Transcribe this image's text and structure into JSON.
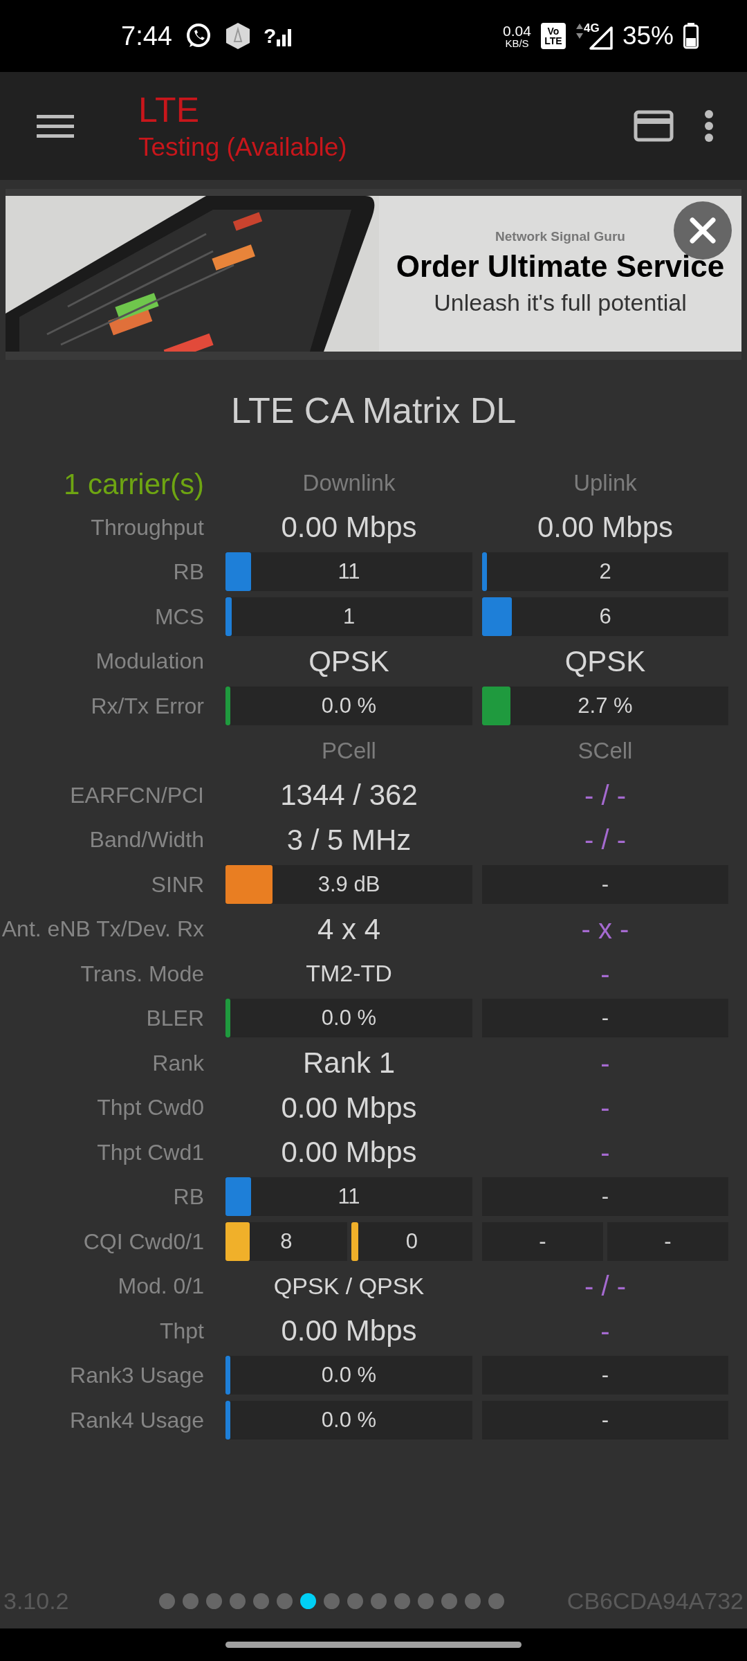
{
  "status_bar": {
    "time": "7:44",
    "signal_mark": "?",
    "speed": "0.04",
    "speed_unit": "KB/S",
    "volte_top": "Vo",
    "volte_bottom": "LTE",
    "network": "4G",
    "battery": "35%"
  },
  "app_bar": {
    "title": "LTE",
    "subtitle": "Testing (Available)"
  },
  "ad": {
    "brand": "Network Signal Guru",
    "headline": "Order Ultimate Service",
    "tagline": "Unleash it's full potential"
  },
  "matrix": {
    "title": "LTE CA Matrix DL",
    "rows": [
      {
        "kind": "header",
        "label": "1 carrier(s)",
        "cells": [
          {
            "kind": "heading",
            "text": "Downlink"
          },
          {
            "kind": "heading",
            "text": "Uplink"
          }
        ]
      },
      {
        "kind": "data",
        "label": "Throughput",
        "cells": [
          {
            "kind": "big",
            "text": "0.00 Mbps"
          },
          {
            "kind": "big",
            "text": "0.00 Mbps"
          }
        ]
      },
      {
        "kind": "data",
        "label": "RB",
        "cells": [
          {
            "kind": "bar",
            "text": "11",
            "level": 0.105,
            "color": "#1e7fd8"
          },
          {
            "kind": "bar",
            "text": "2",
            "level": 0.02,
            "color": "#1e7fd8"
          }
        ]
      },
      {
        "kind": "data",
        "label": "MCS",
        "cells": [
          {
            "kind": "bar",
            "text": "1",
            "level": 0.025,
            "color": "#1e7fd8"
          },
          {
            "kind": "bar",
            "text": "6",
            "level": 0.12,
            "color": "#1e7fd8"
          }
        ]
      },
      {
        "kind": "data",
        "label": "Modulation",
        "cells": [
          {
            "kind": "big",
            "text": "QPSK"
          },
          {
            "kind": "big",
            "text": "QPSK"
          }
        ]
      },
      {
        "kind": "data",
        "label": "Rx/Tx Error",
        "cells": [
          {
            "kind": "bar",
            "text": "0.0 %",
            "level": 0.02,
            "color": "#1f9a3e"
          },
          {
            "kind": "bar",
            "text": "2.7 %",
            "level": 0.115,
            "color": "#1f9a3e"
          }
        ]
      },
      {
        "kind": "header",
        "cells": [
          {
            "kind": "heading",
            "text": "PCell"
          },
          {
            "kind": "heading",
            "text": "SCell"
          }
        ]
      },
      {
        "kind": "data",
        "label": "EARFCN/PCI",
        "cells": [
          {
            "kind": "big",
            "text": "1344 / 362"
          },
          {
            "kind": "empty",
            "text": "- / -"
          }
        ]
      },
      {
        "kind": "data",
        "label": "Band/Width",
        "cells": [
          {
            "kind": "big",
            "text": "3 / 5 MHz"
          },
          {
            "kind": "empty",
            "text": "- / -"
          }
        ]
      },
      {
        "kind": "data",
        "label": "SINR",
        "cells": [
          {
            "kind": "bar",
            "text": "3.9 dB",
            "level": 0.19,
            "color": "#e97e22"
          },
          {
            "kind": "box",
            "text": "-"
          }
        ]
      },
      {
        "kind": "data",
        "label": "Ant. eNB Tx/Dev. Rx",
        "cells": [
          {
            "kind": "big",
            "text": "4 x 4"
          },
          {
            "kind": "empty",
            "text": "- x -"
          }
        ]
      },
      {
        "kind": "data",
        "label": "Trans. Mode",
        "cells": [
          {
            "kind": "text",
            "text": "TM2-TD"
          },
          {
            "kind": "empty",
            "text": "-"
          }
        ]
      },
      {
        "kind": "data",
        "label": "BLER",
        "cells": [
          {
            "kind": "bar",
            "text": "0.0 %",
            "level": 0.02,
            "color": "#1f9a3e"
          },
          {
            "kind": "box",
            "text": "-"
          }
        ]
      },
      {
        "kind": "data",
        "label": "Rank",
        "cells": [
          {
            "kind": "big",
            "text": "Rank 1"
          },
          {
            "kind": "empty",
            "text": "-"
          }
        ]
      },
      {
        "kind": "data",
        "label": "Thpt Cwd0",
        "cells": [
          {
            "kind": "big",
            "text": "0.00 Mbps"
          },
          {
            "kind": "empty",
            "text": "-"
          }
        ]
      },
      {
        "kind": "data",
        "label": "Thpt Cwd1",
        "cells": [
          {
            "kind": "big",
            "text": "0.00 Mbps"
          },
          {
            "kind": "empty",
            "text": "-"
          }
        ]
      },
      {
        "kind": "data",
        "label": "RB",
        "cells": [
          {
            "kind": "bar",
            "text": "11",
            "level": 0.105,
            "color": "#1e7fd8"
          },
          {
            "kind": "box",
            "text": "-"
          }
        ]
      },
      {
        "kind": "data",
        "label": "CQI Cwd0/1",
        "cells": [
          {
            "kind": "split",
            "parts": [
              {
                "kind": "bar",
                "text": "8",
                "level": 0.2,
                "color": "#f0b02a"
              },
              {
                "kind": "bar",
                "text": "0",
                "level": 0.06,
                "color": "#f0b02a"
              }
            ]
          },
          {
            "kind": "split",
            "parts": [
              {
                "kind": "box",
                "text": "-"
              },
              {
                "kind": "box",
                "text": "-"
              }
            ]
          }
        ]
      },
      {
        "kind": "data",
        "label": "Mod. 0/1",
        "cells": [
          {
            "kind": "text",
            "text": "QPSK / QPSK"
          },
          {
            "kind": "empty",
            "text": "- / -"
          }
        ]
      },
      {
        "kind": "data",
        "label": "Thpt",
        "cells": [
          {
            "kind": "big",
            "text": "0.00 Mbps"
          },
          {
            "kind": "empty",
            "text": "-"
          }
        ]
      },
      {
        "kind": "data",
        "label": "Rank3 Usage",
        "cells": [
          {
            "kind": "bar",
            "text": "0.0 %",
            "level": 0.02,
            "color": "#1e7fd8"
          },
          {
            "kind": "box",
            "text": "-"
          }
        ]
      },
      {
        "kind": "data",
        "label": "Rank4 Usage",
        "cells": [
          {
            "kind": "bar",
            "text": "0.0 %",
            "level": 0.02,
            "color": "#1e7fd8"
          },
          {
            "kind": "box",
            "text": "-"
          }
        ]
      }
    ]
  },
  "footer": {
    "version": "3.10.2",
    "pages": [
      {
        "selected": false
      },
      {
        "selected": false
      },
      {
        "selected": false
      },
      {
        "selected": false
      },
      {
        "selected": false
      },
      {
        "selected": false
      },
      {
        "selected": true
      },
      {
        "selected": false
      },
      {
        "selected": false
      },
      {
        "selected": false
      },
      {
        "selected": false
      },
      {
        "selected": false
      },
      {
        "selected": false
      },
      {
        "selected": false
      },
      {
        "selected": false
      }
    ],
    "device_id": "CB6CDA94A732"
  }
}
